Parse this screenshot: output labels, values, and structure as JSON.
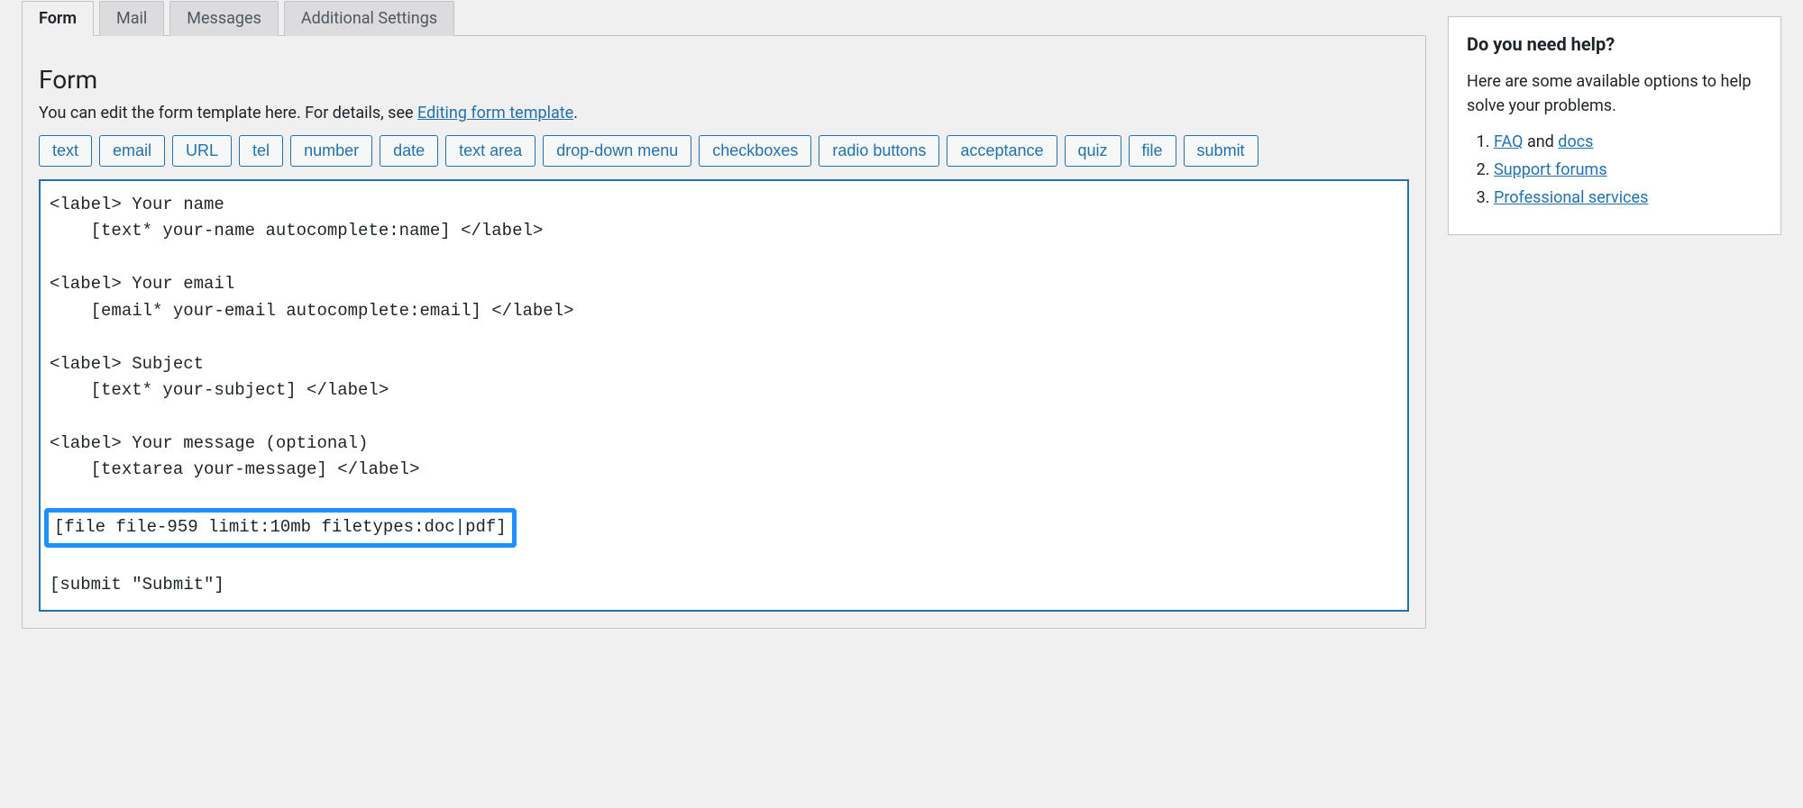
{
  "tabs": [
    {
      "label": "Form",
      "active": true
    },
    {
      "label": "Mail",
      "active": false
    },
    {
      "label": "Messages",
      "active": false
    },
    {
      "label": "Additional Settings",
      "active": false
    }
  ],
  "section": {
    "title": "Form",
    "desc_prefix": "You can edit the form template here. For details, see ",
    "desc_link": "Editing form template",
    "desc_suffix": "."
  },
  "tag_buttons": [
    "text",
    "email",
    "URL",
    "tel",
    "number",
    "date",
    "text area",
    "drop-down menu",
    "checkboxes",
    "radio buttons",
    "acceptance",
    "quiz",
    "file",
    "submit"
  ],
  "code": {
    "l1": "<label> Your name",
    "l2": "    [text* your-name autocomplete:name] </label>",
    "l3": "",
    "l4": "<label> Your email",
    "l5": "    [email* your-email autocomplete:email] </label>",
    "l6": "",
    "l7": "<label> Subject",
    "l8": "    [text* your-subject] </label>",
    "l9": "",
    "l10": "<label> Your message (optional)",
    "l11": "    [textarea your-message] </label>",
    "l12": "",
    "hl": "[file file-959 limit:10mb filetypes:doc|pdf]",
    "l14": "",
    "l15": "[submit \"Submit\"]"
  },
  "help": {
    "title": "Do you need help?",
    "intro": "Here are some available options to help solve your problems.",
    "items": [
      {
        "link": "FAQ",
        "after": " and ",
        "link2": "docs"
      },
      {
        "link": "Support forums"
      },
      {
        "link": "Professional services"
      }
    ]
  }
}
